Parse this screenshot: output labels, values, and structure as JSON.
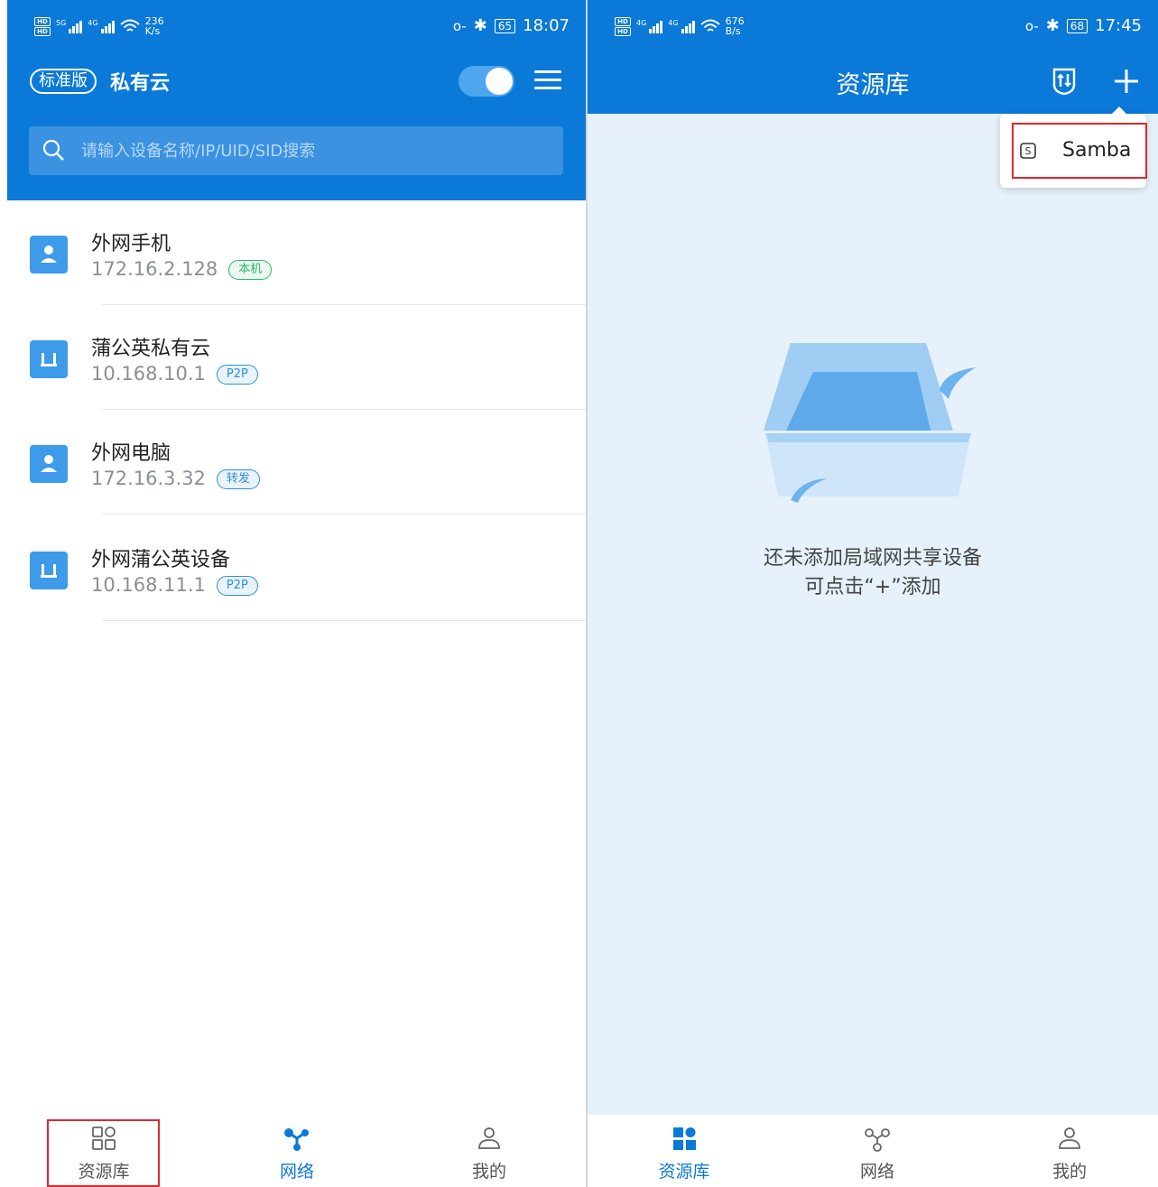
{
  "left": {
    "status": {
      "speed_value": "236",
      "speed_unit": "K/s",
      "battery": "65",
      "time": "18:07"
    },
    "header": {
      "edition_badge": "标准版",
      "title": "私有云"
    },
    "search": {
      "placeholder": "请输入设备名称/IP/UID/SID搜索"
    },
    "devices": [
      {
        "name": "外网手机",
        "ip": "172.16.2.128",
        "tag": "本机",
        "icon": "person-icon"
      },
      {
        "name": "蒲公英私有云",
        "ip": "10.168.10.1",
        "tag": "P2P",
        "icon": "router-icon"
      },
      {
        "name": "外网电脑",
        "ip": "172.16.3.32",
        "tag": "转发",
        "icon": "person-icon"
      },
      {
        "name": "外网蒲公英设备",
        "ip": "10.168.11.1",
        "tag": "P2P",
        "icon": "router-icon"
      }
    ],
    "nav": {
      "resources": "资源库",
      "network": "网络",
      "mine": "我的"
    }
  },
  "right": {
    "status": {
      "speed_value": "676",
      "speed_unit": "B/s",
      "battery": "68",
      "time": "17:45"
    },
    "header": {
      "title": "资源库"
    },
    "popup": {
      "item": "Samba"
    },
    "empty": {
      "line1": "还未添加局域网共享设备",
      "line2": "可点击“+”添加"
    },
    "nav": {
      "resources": "资源库",
      "network": "网络",
      "mine": "我的"
    }
  },
  "colors": {
    "primary": "#0b79d8",
    "highlight": "#e3262b",
    "tag_green": "#31b56a",
    "tag_blue": "#2e8fe0"
  }
}
